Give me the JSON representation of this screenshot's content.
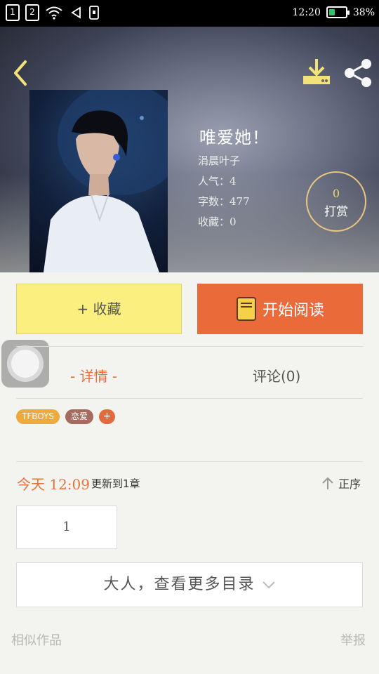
{
  "status_bar": {
    "sim1": "1",
    "sim2": "2",
    "time": "12:20",
    "battery": "38%",
    "battery_level": 0.38,
    "icons": [
      "wifi-icon",
      "mute-icon",
      "sim-card-icon"
    ]
  },
  "header": {
    "back_icon": "chevron-left-icon",
    "download_icon": "download-icon",
    "share_icon": "share-icon"
  },
  "book": {
    "title": "唯爱她！",
    "author": "涓晨叶子",
    "popularity": "人气：4",
    "word_count": "字数：477",
    "favorites": "收藏：0"
  },
  "reward": {
    "count": "0",
    "label": "打赏"
  },
  "actions": {
    "favorite_label": "+ 收藏",
    "read_label": "开始阅读",
    "read_icon": "book-icon"
  },
  "tabs": {
    "detail": "- 详情 -",
    "comment": "评论(0)"
  },
  "tags": [
    "TFBOYS",
    "恋爱",
    "+"
  ],
  "update": {
    "time": "今天 12:09",
    "text": "更新到1章",
    "sort_label": "正序",
    "sort_icon": "arrow-up-icon"
  },
  "chapters": {
    "first": "1"
  },
  "catalog": {
    "label": "大人，查看更多目录",
    "icon": "chevron-down-icon"
  },
  "footer": {
    "similar": "相似作品",
    "report": "举报"
  },
  "colors": {
    "accent_orange": "#ea6a3a",
    "favorite_yellow": "#fbf07f",
    "tag_gold": "#eeaa3c",
    "tag_brown": "#a56b5f"
  }
}
